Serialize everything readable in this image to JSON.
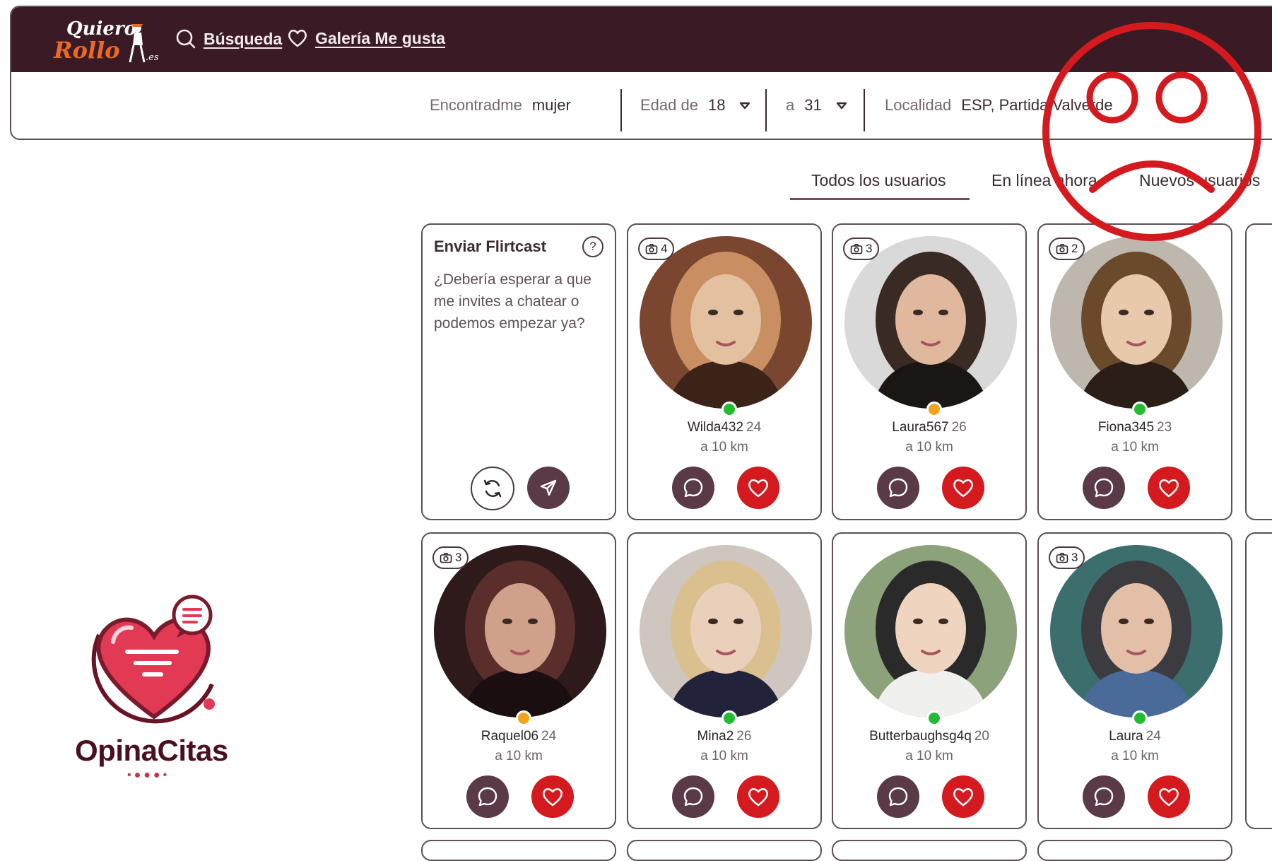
{
  "brand": {
    "logo_line1": "Quiero",
    "logo_line2": "Rollo",
    "logo_suffix": ".es"
  },
  "nav": {
    "search_label": "Búsqueda",
    "gallery_label": "Galería Me gusta"
  },
  "filters": {
    "find_label": "Encontradme",
    "find_value": "mujer",
    "age_from_label": "Edad de",
    "age_from_value": "18",
    "age_to_label": "a",
    "age_to_value": "31",
    "location_label": "Localidad",
    "location_value": "ESP, Partida Valverde"
  },
  "tabs": [
    {
      "label": "Todos los usuarios",
      "active": true
    },
    {
      "label": "En línea ahora",
      "active": false
    },
    {
      "label": "Nuevos usuarios",
      "active": false
    }
  ],
  "flirtcast": {
    "title": "Enviar Flirtcast",
    "help": "?",
    "message": "¿Debería esperar a que me invites a chatear o podemos empezar ya?"
  },
  "users": [
    {
      "name": "Wilda432",
      "age": "24",
      "distance": "a 10 km",
      "photos": "4",
      "status": "online"
    },
    {
      "name": "Laura567",
      "age": "26",
      "distance": "a 10 km",
      "photos": "3",
      "status": "away"
    },
    {
      "name": "Fiona345",
      "age": "23",
      "distance": "a 10 km",
      "photos": "2",
      "status": "online"
    },
    {
      "name": "Raquel06",
      "age": "24",
      "distance": "a 10 km",
      "photos": "3",
      "status": "away"
    },
    {
      "name": "Mina2",
      "age": "26",
      "distance": "a 10 km",
      "photos": "",
      "status": "online"
    },
    {
      "name": "Butterbaughsg4q",
      "age": "20",
      "distance": "a 10 km",
      "photos": "",
      "status": "online"
    },
    {
      "name": "Laura",
      "age": "24",
      "distance": "a 10 km",
      "photos": "3",
      "status": "online"
    }
  ],
  "watermark": {
    "name": "OpinaCitas"
  },
  "colors": {
    "header_bg": "#3a1b25",
    "like_red": "#d41a1f",
    "chat_plum": "#5b3a47",
    "online": "#22bb33",
    "away": "#f2a21b",
    "overlay_red": "#d41a1f"
  }
}
